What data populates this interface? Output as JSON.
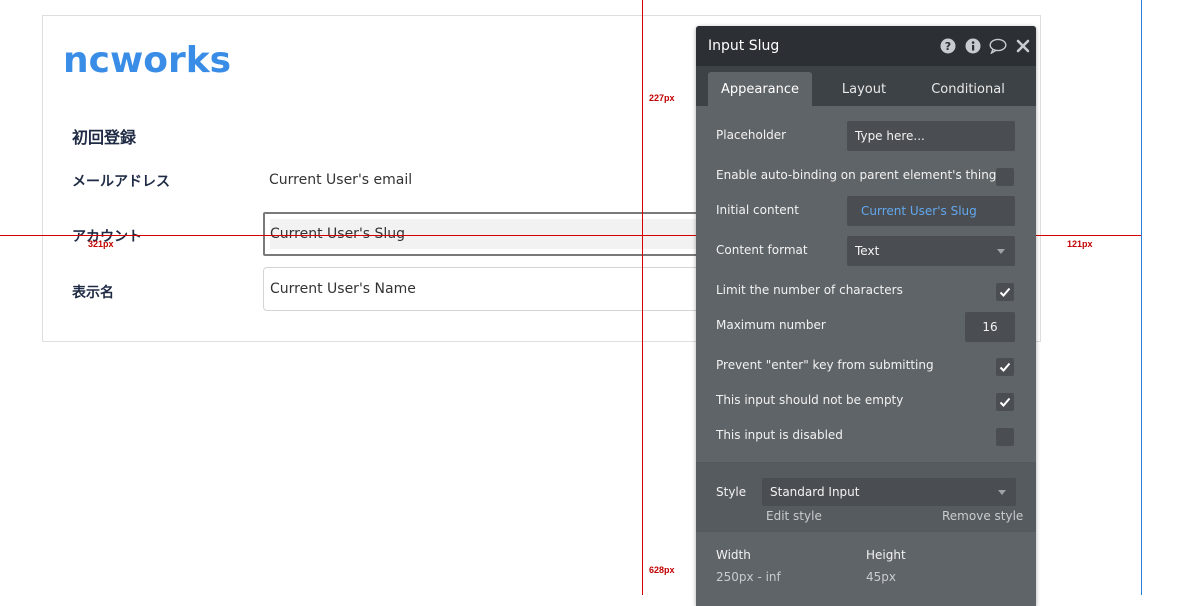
{
  "page": {
    "brand": "ncworks",
    "section_title": "初回登録",
    "rows": [
      {
        "label": "メールアドレス",
        "value": "Current User's email"
      },
      {
        "label": "アカウント",
        "value": "Current User's Slug"
      },
      {
        "label": "表示名",
        "value": "Current User's Name"
      }
    ]
  },
  "guides": {
    "top_label": "227px",
    "bottom_label": "628px",
    "left_label": "321px",
    "right_label": "121px"
  },
  "editor": {
    "title": "Input Slug",
    "header_icons": [
      "help-icon",
      "info-icon",
      "comment-icon",
      "close-icon"
    ],
    "tabs": [
      "Appearance",
      "Layout",
      "Conditional"
    ],
    "active_tab": "Appearance",
    "placeholder_label": "Placeholder",
    "placeholder_value": "Type here...",
    "auto_binding_label": "Enable auto-binding on parent element's thing",
    "auto_binding_checked": false,
    "initial_content_label": "Initial content",
    "initial_content_value": "Current User's Slug",
    "content_format_label": "Content format",
    "content_format_value": "Text",
    "limit_label": "Limit the number of characters",
    "limit_checked": true,
    "max_label": "Maximum number",
    "max_value": "16",
    "prevent_enter_label": "Prevent \"enter\" key from submitting",
    "prevent_enter_checked": true,
    "not_empty_label": "This input should not be empty",
    "not_empty_checked": true,
    "disabled_label": "This input is disabled",
    "disabled_checked": false,
    "style_label": "Style",
    "style_value": "Standard Input",
    "edit_style": "Edit style",
    "remove_style": "Remove style",
    "width_label": "Width",
    "width_value": "250px - inf",
    "height_label": "Height",
    "height_value": "45px"
  },
  "colors": {
    "brand": "#3a8de6",
    "guide_red": "#d40000",
    "guide_blue": "#2a7fd8",
    "editor_bg": "#5f6468",
    "editor_header": "#2c3035",
    "dynamic_text": "#62a8ef"
  }
}
